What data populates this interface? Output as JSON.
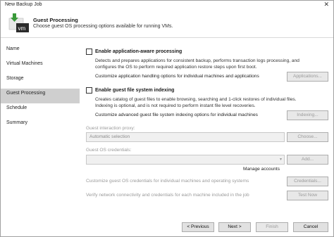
{
  "window": {
    "title": "New Backup Job",
    "close_glyph": "✕"
  },
  "header": {
    "title": "Guest Processing",
    "subtitle": "Choose guest OS processing options available for running VMs.",
    "logo_text": "vm"
  },
  "sidebar": {
    "items": [
      {
        "label": "Name"
      },
      {
        "label": "Virtual Machines"
      },
      {
        "label": "Storage"
      },
      {
        "label": "Guest Processing"
      },
      {
        "label": "Schedule"
      },
      {
        "label": "Summary"
      }
    ]
  },
  "app_aware": {
    "label": "Enable application-aware processing",
    "checked": false,
    "desc_line1": "Detects and prepares applications for consistent backup, performs transaction logs processing, and",
    "desc_line2": "configures the OS to perform required application restore steps upon first boot.",
    "customize_text": "Customize application handling options for individual machines and applications",
    "button": "Applications..."
  },
  "fs_index": {
    "label": "Enable guest file system indexing",
    "checked": false,
    "desc_line1": "Creates catalog of guest files to enable browsing, searching and 1-click restores of individual files.",
    "desc_line2": "Indexing is optional, and is not required to perform instant file level recoveries.",
    "customize_text": "Customize advanced guest file system indexing options for individual machines",
    "button": "Indexing..."
  },
  "proxy": {
    "label": "Guest interaction proxy:",
    "value": "Automatic selection",
    "button": "Choose..."
  },
  "credentials": {
    "label": "Guest OS credentials:",
    "value": "",
    "add_button": "Add...",
    "manage_link": "Manage accounts"
  },
  "per_machine": {
    "text": "Customize guest OS credentials for individual machines and operating systems",
    "button": "Credentials..."
  },
  "verify": {
    "text": "Verify network connectivity and credentials for each machine included in the job",
    "button": "Test Now"
  },
  "footer": {
    "previous": "< Previous",
    "next": "Next >",
    "finish": "Finish",
    "cancel": "Cancel"
  }
}
